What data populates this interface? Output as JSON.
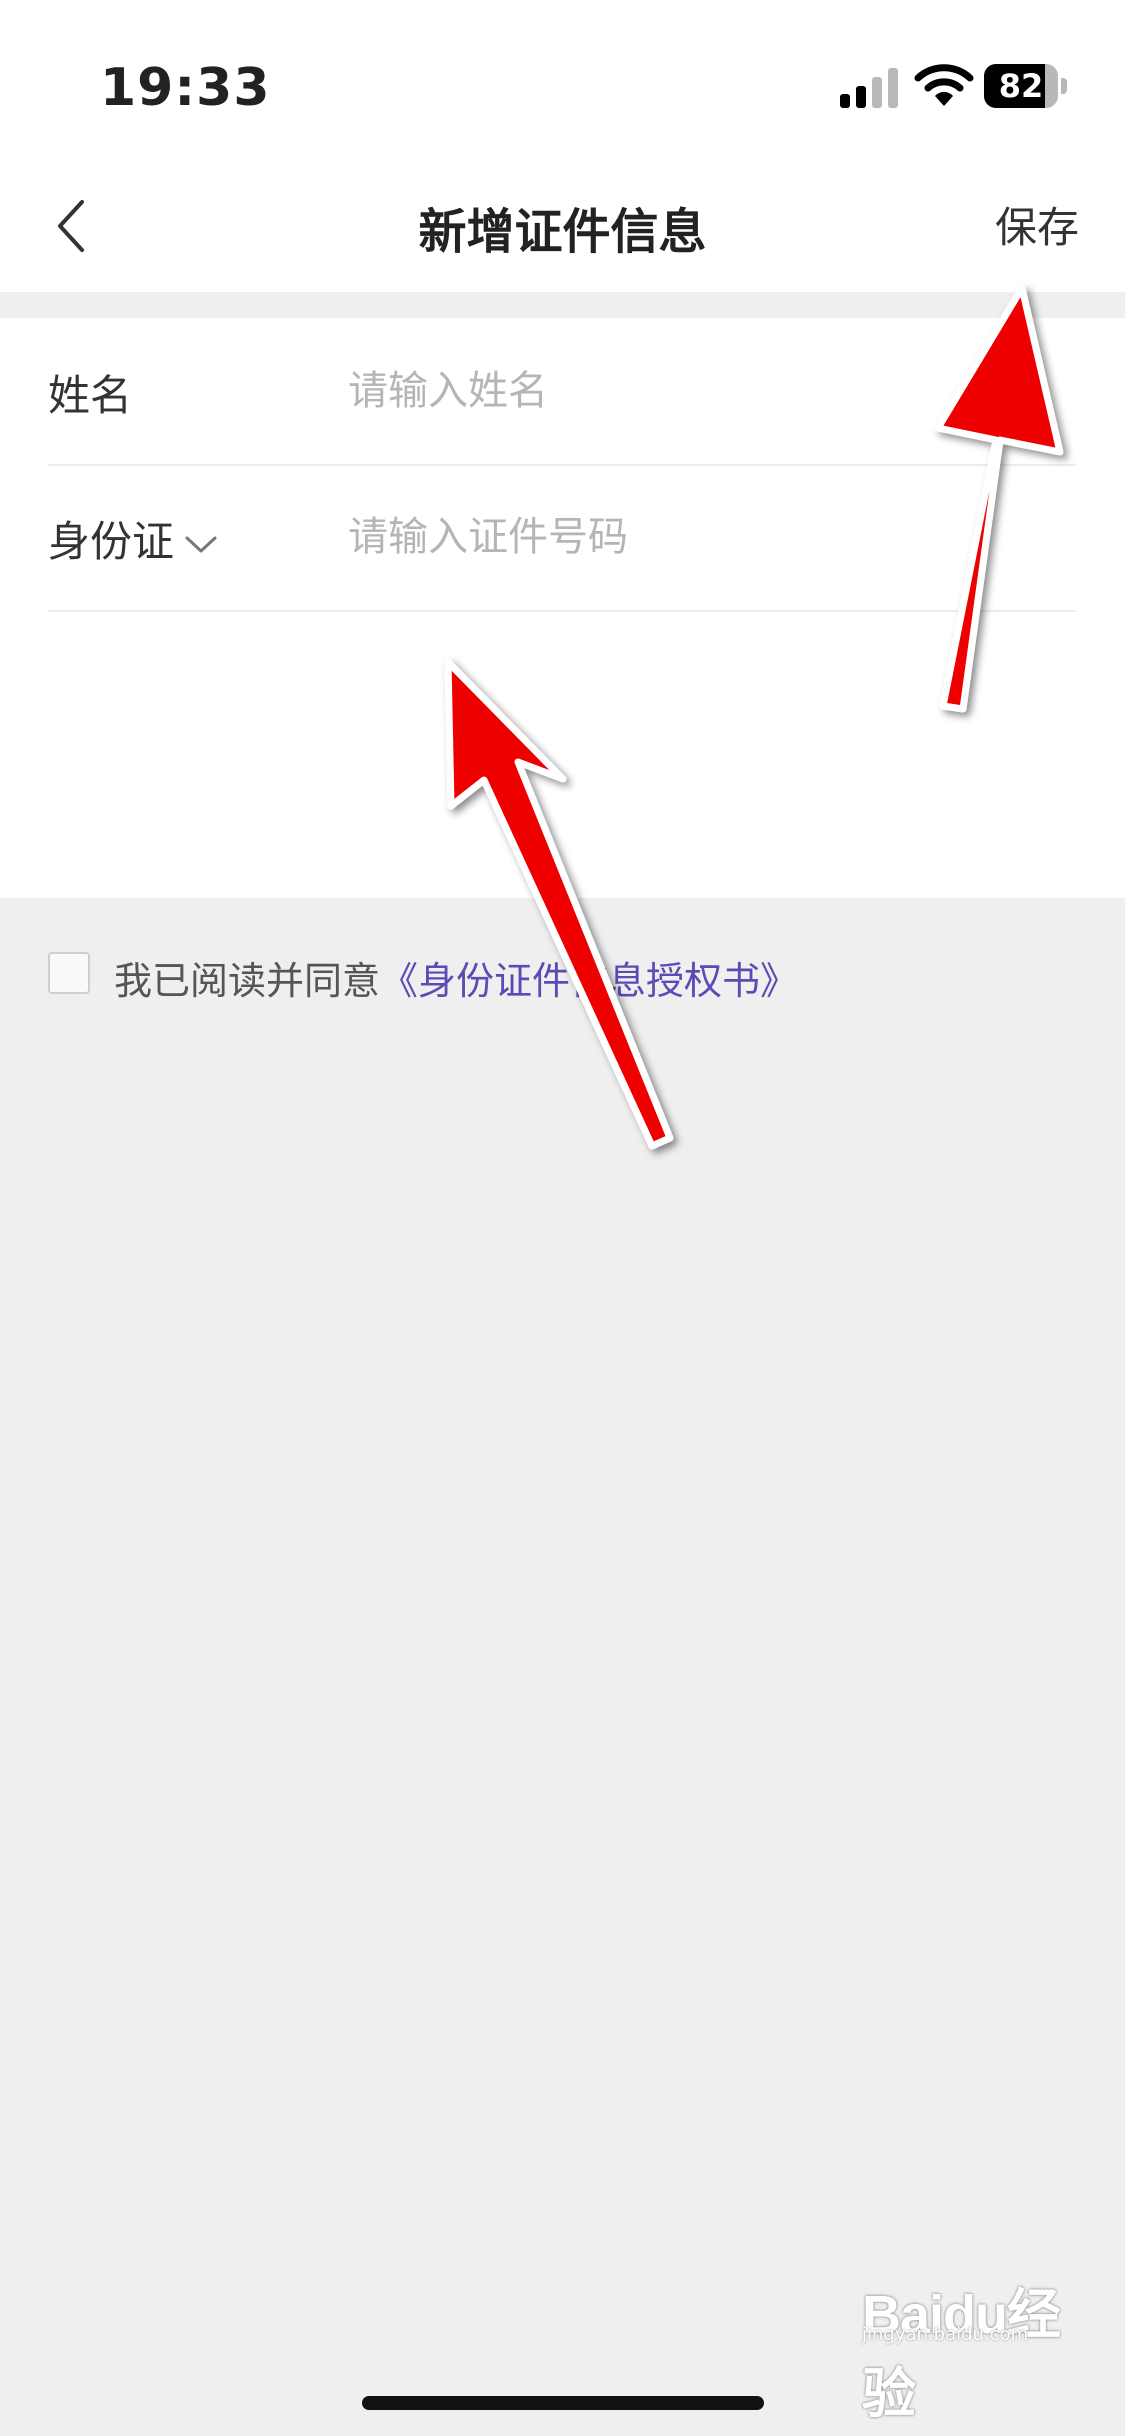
{
  "status_bar": {
    "time": "19:33",
    "battery_level": "82",
    "battery_fraction": 0.82
  },
  "nav": {
    "title": "新增证件信息",
    "save_label": "保存"
  },
  "form": {
    "name_label": "姓名",
    "name_placeholder": "请输入姓名",
    "name_value": "",
    "id_type_label": "身份证",
    "id_number_placeholder": "请输入证件号码",
    "id_number_value": ""
  },
  "agreement": {
    "checked": false,
    "text": "我已阅读并同意",
    "link_text": "《身份证件信息授权书》"
  },
  "watermark": {
    "text": "Baidu经验",
    "sub": "jingyan.baidu.com"
  },
  "colors": {
    "link": "#5c4bb5",
    "annotation_arrow": "#ee0000",
    "background": "#efefef"
  }
}
